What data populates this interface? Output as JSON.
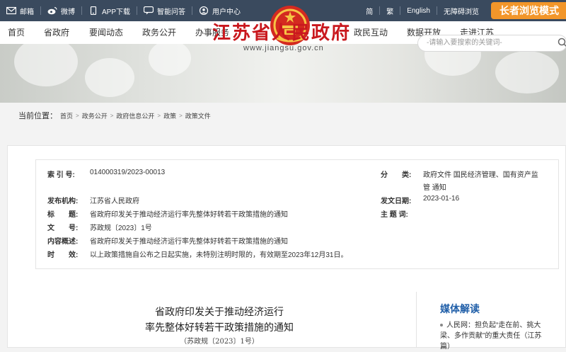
{
  "topbar": {
    "mailbox": "邮箱",
    "weibo": "微博",
    "app_download": "APP下载",
    "smart_qa": "智能问答",
    "user_center": "用户中心",
    "simplified": "简",
    "traditional": "繁",
    "english": "English",
    "accessible": "无障碍浏览",
    "elder_mode": "长者浏览模式"
  },
  "nav": {
    "home": "首页",
    "provincial_gov": "省政府",
    "news": "要闻动态",
    "gov_affairs": "政务公开",
    "services": "办事服务",
    "interaction": "政民互动",
    "open_data": "数据开放",
    "into_jiangsu": "走进江苏"
  },
  "banner": {
    "site_title": "江苏省人民政府",
    "site_url": "www.jiangsu.gov.cn"
  },
  "search": {
    "placeholder": "-请输入要搜索的关键词-"
  },
  "breadcrumb": {
    "label": "当前位置：",
    "items": [
      "首页",
      "政务公开",
      "政府信息公开",
      "政策",
      "政策文件"
    ]
  },
  "meta": {
    "index_label": "索 引 号:",
    "index_value": "014000319/2023-00013",
    "category_label": "分　　类:",
    "category_value_line1": "政府文件 国民经济管理、国有资产监",
    "category_value_line2": "管 通知",
    "issuer_label": "发布机构:",
    "issuer_value": "江苏省人民政府",
    "date_label": "发文日期:",
    "date_value": "2023-01-16",
    "title_label": "标　　题:",
    "title_value": "省政府印发关于推动经济运行率先整体好转若干政策措施的通知",
    "subject_label": "主 题 词:",
    "subject_value": "",
    "docno_label": "文　　号:",
    "docno_value": "苏政规〔2023〕1号",
    "summary_label": "内容概述:",
    "summary_value": "省政府印发关于推动经济运行率先整体好转若干政策措施的通知",
    "validity_label": "时　　效:",
    "validity_value": "以上政策措施自公布之日起实施，未特别注明时限的，有效期至2023年12月31日。"
  },
  "article": {
    "title_line1": "省政府印发关于推动经济运行",
    "title_line2": "率先整体好转若干政策措施的通知",
    "doc_number": "（苏政规〔2023〕1号）"
  },
  "media": {
    "heading": "媒体解读",
    "item1": "人民网：担负起“走在前、挑大梁、多作贡献”的重大责任（江苏篇）"
  }
}
